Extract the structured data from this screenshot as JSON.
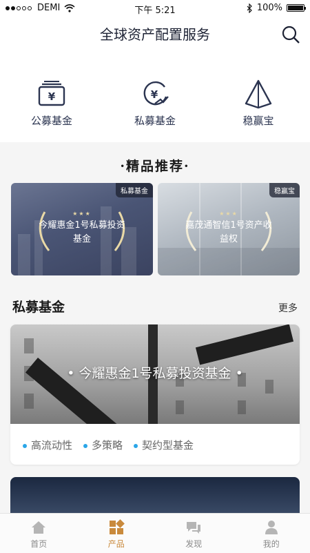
{
  "status_bar": {
    "carrier": "DEMI",
    "time": "下午 5:21",
    "battery": "100%"
  },
  "header": {
    "title": "全球资产配置服务"
  },
  "categories": [
    {
      "label": "公募基金",
      "icon": "wallet-yen-icon"
    },
    {
      "label": "私募基金",
      "icon": "yen-growth-icon"
    },
    {
      "label": "稳赢宝",
      "icon": "pyramid-icon"
    }
  ],
  "featured": {
    "title": "·精品推荐·",
    "items": [
      {
        "tag": "私募基金",
        "text": "今耀惠金1号私募投资基金"
      },
      {
        "tag": "稳赢宝",
        "text": "嘉茂通智信1号资产收益权"
      }
    ]
  },
  "section": {
    "title": "私募基金",
    "more": "更多"
  },
  "fund_card": {
    "title": "• 今耀惠金1号私募投资基金 •",
    "tags": [
      "高流动性",
      "多策略",
      "契约型基金"
    ],
    "dot_color": "#2aa6e8"
  },
  "tabbar": {
    "active_color": "#c98a3c",
    "items": [
      {
        "label": "首页",
        "icon": "home-icon"
      },
      {
        "label": "产品",
        "icon": "grid-icon"
      },
      {
        "label": "发现",
        "icon": "chat-icon"
      },
      {
        "label": "我的",
        "icon": "user-icon"
      }
    ]
  }
}
